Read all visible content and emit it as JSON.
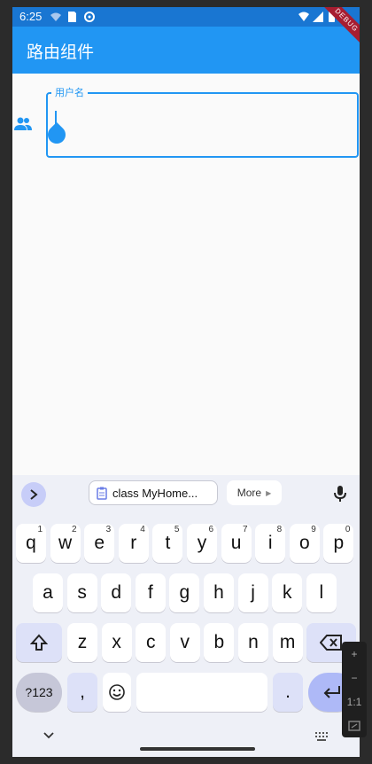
{
  "status_bar": {
    "time": "6:25"
  },
  "app_bar": {
    "title": "路由组件",
    "debug_banner": "DEBUG"
  },
  "form": {
    "username_label": "用户名"
  },
  "keyboard": {
    "clipboard_suggestion": "class MyHome...",
    "more_label": "More",
    "row1": [
      {
        "letter": "q",
        "num": "1"
      },
      {
        "letter": "w",
        "num": "2"
      },
      {
        "letter": "e",
        "num": "3"
      },
      {
        "letter": "r",
        "num": "4"
      },
      {
        "letter": "t",
        "num": "5"
      },
      {
        "letter": "y",
        "num": "6"
      },
      {
        "letter": "u",
        "num": "7"
      },
      {
        "letter": "i",
        "num": "8"
      },
      {
        "letter": "o",
        "num": "9"
      },
      {
        "letter": "p",
        "num": "0"
      }
    ],
    "row2": [
      "a",
      "s",
      "d",
      "f",
      "g",
      "h",
      "j",
      "k",
      "l"
    ],
    "row3": [
      "z",
      "x",
      "c",
      "v",
      "b",
      "n",
      "m"
    ],
    "symbols_label": "?123",
    "comma": ",",
    "period": ".",
    "space": ""
  },
  "zoom_panel": {
    "plus": "+",
    "minus": "−",
    "ratio": "1:1"
  }
}
